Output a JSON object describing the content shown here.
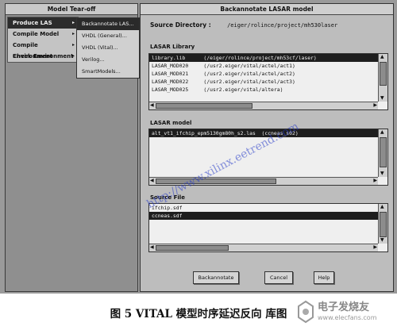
{
  "tearoff": {
    "title": "Model Tear-off",
    "menu": [
      {
        "label": "Produce LAS",
        "active": true
      },
      {
        "label": "Compile Model",
        "active": false
      },
      {
        "label": "Compile Environment",
        "active": false
      },
      {
        "label": "Check Environment",
        "active": false
      }
    ],
    "submenu": [
      {
        "label": "Backannotate LAS...",
        "active": true
      },
      {
        "label": "VHDL (General)...",
        "active": false
      },
      {
        "label": "VHDL (Vital)...",
        "active": false
      },
      {
        "label": "Verilog...",
        "active": false
      },
      {
        "label": "SmartModels...",
        "active": false
      }
    ]
  },
  "dialog": {
    "title": "Backannotate LASAR model",
    "source_directory_label": "Source Directory :",
    "source_directory_value": "/eiger/rolince/project/mh530laser",
    "lasar_library": {
      "label": "LASAR Library",
      "rows": [
        "library.lib      (/eiger/rolince/project/mh53cf/laser)",
        "LASAR_MOD020     (/usr2.eiger/vital/actel/act1)",
        "LASAR_MOD021     (/usr2.eiger/vital/actel/act2)",
        "LASAR_MOD022     (/usr2.eiger/vital/actel/act3)",
        "LASAR_MOD025     (/usr2.eiger/vital/altera)"
      ]
    },
    "lasar_model": {
      "label": "LASAR model",
      "rows": [
        "alt_vt1_ifchip_epm5130gm80h_s2.las  (ccneas_s02)"
      ]
    },
    "source_file": {
      "label": "Source File",
      "rows": [
        "ifchip.sdf",
        "ccneas.sdf"
      ]
    },
    "buttons": {
      "backannotate": "Backannotate",
      "cancel": "Cancel",
      "help": "Help"
    }
  },
  "watermark": "http://www.xilinx.eetrend.com",
  "caption": "图 5   VITAL 模型时序延迟反向   库图",
  "logo": {
    "line1": "电子发烧友",
    "line2": "www.elecfans.com"
  },
  "colors": {
    "selection": "#1e1e1e",
    "dialog_bg": "#bdbdbd",
    "watermark": "#3c3cc8"
  }
}
